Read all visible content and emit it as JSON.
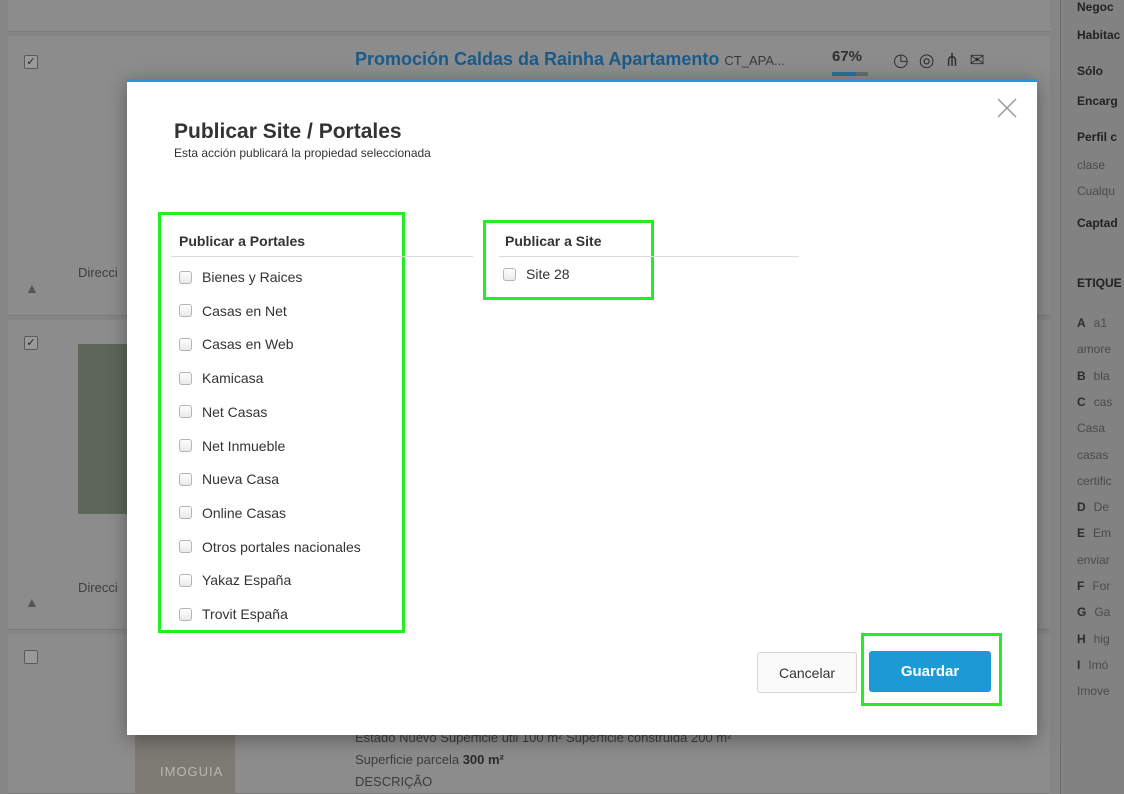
{
  "background": {
    "listing_title": "Promoción Caldas da Rainha Apartamento",
    "listing_ref": "CT_APA...",
    "progress_label": "67%",
    "progress_value": 0.67,
    "address_label_1": "Direcci",
    "address_label_2": "Direcci",
    "detail_line_1": "Estado Nuevo   Superficie útil 100 m²   Superficie construida 200 m²",
    "detail_line_2_label": "Superficie parcela",
    "detail_line_2_value": "300 m²",
    "detail_line_3": "DESCRIÇÃO",
    "logo_text": "IMOGUIA",
    "sidebar": {
      "items": [
        "Negoc",
        "Habitac",
        "Sólo",
        "Encarg",
        "Perfil c",
        "clase",
        "Cualqu",
        "Captad",
        "ETIQUE"
      ],
      "tags": [
        {
          "letter": "A",
          "text": "a1"
        },
        {
          "letter": "",
          "text": "amore"
        },
        {
          "letter": "B",
          "text": "bla"
        },
        {
          "letter": "C",
          "text": "cas"
        },
        {
          "letter": "",
          "text": "Casa"
        },
        {
          "letter": "",
          "text": "casas"
        },
        {
          "letter": "",
          "text": "certific"
        },
        {
          "letter": "D",
          "text": "De"
        },
        {
          "letter": "E",
          "text": "Em"
        },
        {
          "letter": "",
          "text": "enviar"
        },
        {
          "letter": "F",
          "text": "For"
        },
        {
          "letter": "G",
          "text": "Ga"
        },
        {
          "letter": "H",
          "text": "hig"
        },
        {
          "letter": "I",
          "text": "Imó"
        },
        {
          "letter": "",
          "text": "Imove"
        }
      ]
    }
  },
  "modal": {
    "title": "Publicar Site / Portales",
    "subtitle": "Esta acción publicará la propiedad seleccionada",
    "close_icon": "close-icon",
    "portales": {
      "heading": "Publicar a Portales",
      "options": [
        "Bienes y Raices",
        "Casas en Net",
        "Casas en Web",
        "Kamicasa",
        "Net Casas",
        "Net Inmueble",
        "Nueva Casa",
        "Online Casas",
        "Otros portales nacionales",
        "Yakaz España",
        "Trovit España"
      ]
    },
    "site": {
      "heading": "Publicar a Site",
      "options": [
        "Site 28"
      ]
    },
    "buttons": {
      "cancel": "Cancelar",
      "save": "Guardar"
    }
  },
  "colors": {
    "accent": "#1d9ad6",
    "highlight": "#22ee22"
  }
}
